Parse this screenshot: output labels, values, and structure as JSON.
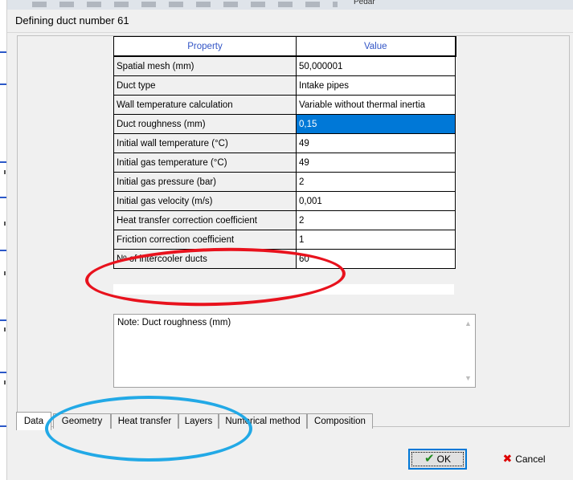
{
  "dialog": {
    "title": "Defining duct number 61"
  },
  "background": {
    "toolbar_text": "Pedar"
  },
  "grid": {
    "header_property": "Property",
    "header_value": "Value",
    "rows": [
      {
        "property": "Spatial mesh (mm)",
        "value": "50,000001"
      },
      {
        "property": "Duct type",
        "value": "Intake pipes"
      },
      {
        "property": "Wall temperature calculation",
        "value": "Variable without thermal inertia"
      },
      {
        "property": "Duct roughness (mm)",
        "value": "0,15"
      },
      {
        "property": "Initial wall temperature (°C)",
        "value": "49"
      },
      {
        "property": "Initial gas temperature (°C)",
        "value": "49"
      },
      {
        "property": "Initial gas pressure (bar)",
        "value": "2"
      },
      {
        "property": "Initial gas velocity (m/s)",
        "value": "0,001"
      },
      {
        "property": "Heat transfer correction coefficient",
        "value": "2"
      },
      {
        "property": "Friction correction coefficient",
        "value": "1"
      },
      {
        "property": "Nº of intercooler ducts",
        "value": "60"
      }
    ],
    "selected_index": 3
  },
  "note": {
    "text": "Note: Duct roughness (mm)"
  },
  "tabs": [
    "Data",
    "Geometry",
    "Heat transfer",
    "Layers",
    "Numerical method",
    "Composition"
  ],
  "active_tab": "Data",
  "buttons": {
    "ok": "OK",
    "cancel": "Cancel"
  },
  "annotation_colors": {
    "red_ellipse": "#e8121d",
    "blue_ellipse": "#22a9e6"
  }
}
